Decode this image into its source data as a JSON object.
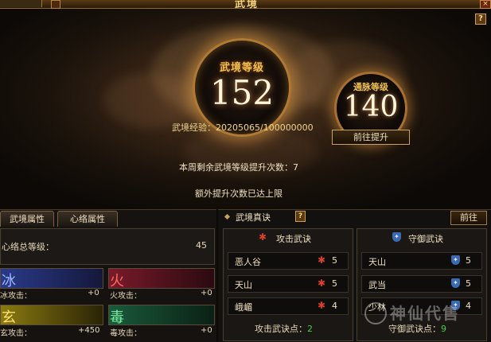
{
  "window": {
    "title": "武境",
    "close_label": "×"
  },
  "hero": {
    "help_label": "?",
    "main_orb": {
      "label": "武境等级",
      "value": "152"
    },
    "meridian_orb": {
      "label": "通脉等级",
      "value": "140"
    },
    "exp_text": "武境经验：20205065/100000000",
    "goto_button": "前往提升",
    "weekly_text": "本周剩余武境等级提升次数：7",
    "extra_text": "额外提升次数已达上限"
  },
  "left_panel": {
    "tabs": [
      {
        "label": "武境属性"
      },
      {
        "label": "心络属性"
      }
    ],
    "total_label": "心络总等级：",
    "total_value": "45",
    "elements": [
      {
        "char": "冰",
        "attack_label": "冰攻击：",
        "attack_value": "+0",
        "color": "#2a3a8a"
      },
      {
        "char": "火",
        "attack_label": "火攻击：",
        "attack_value": "+0",
        "color": "#7a1a2a"
      },
      {
        "char": "玄",
        "attack_label": "玄攻击：",
        "attack_value": "+450",
        "color": "#8a7a10"
      },
      {
        "char": "毒",
        "attack_label": "毒攻击：",
        "attack_value": "+0",
        "color": "#1a5a3a"
      }
    ]
  },
  "right_panel": {
    "title": "武境真诀",
    "help_label": "?",
    "goto_label": "前往",
    "attack": {
      "header": "攻击武诀",
      "rows": [
        {
          "name": "恶人谷",
          "count": "5"
        },
        {
          "name": "天山",
          "count": "5"
        },
        {
          "name": "峨嵋",
          "count": "4"
        }
      ],
      "points_label": "攻击武诀点：",
      "points_value": "2"
    },
    "defense": {
      "header": "守御武诀",
      "rows": [
        {
          "name": "天山",
          "count": "5"
        },
        {
          "name": "武当",
          "count": "5"
        },
        {
          "name": "少林",
          "count": "4"
        }
      ],
      "points_label": "守御武诀点：",
      "points_value": "9"
    }
  },
  "watermark": {
    "text": "神仙代售"
  }
}
